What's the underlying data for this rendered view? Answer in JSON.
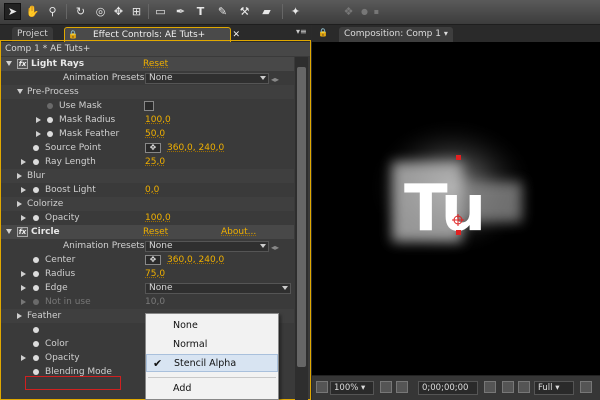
{
  "colors": {
    "accent": "#f0b000",
    "panel": "#3a3a3a",
    "highlight": "#d8e4f2",
    "red": "#d02020"
  },
  "toolbar": {
    "tools": [
      "selection-tool-icon",
      "hand-tool-icon",
      "zoom-tool-icon",
      "rotate-tool-icon",
      "orbit-camera-icon",
      "pan-behind-icon",
      "rectangle-tool-icon",
      "pen-tool-icon",
      "type-tool-icon",
      "brush-tool-icon",
      "eraser-tool-icon",
      "puppet-pin-icon"
    ]
  },
  "left_tabs": {
    "project": "Project",
    "effect_controls": "Effect Controls: AE Tuts+"
  },
  "ec_header": "Comp 1 * AE Tuts+",
  "effects": [
    {
      "name": "Light Rays",
      "reset": "Reset",
      "presets_label": "Animation Presets:",
      "presets_value": "None"
    },
    {
      "name": "Circle",
      "reset": "Reset",
      "about": "About...",
      "presets_label": "Animation Presets:",
      "presets_value": "None"
    }
  ],
  "params": {
    "preprocess": "Pre-Process",
    "use_mask": "Use Mask",
    "mask_radius": "Mask Radius",
    "mask_radius_val": "100,0",
    "mask_feather": "Mask Feather",
    "mask_feather_val": "50,0",
    "source_point": "Source Point",
    "source_point_val": "360,0, 240,0",
    "ray_length": "Ray Length",
    "ray_length_val": "25,0",
    "blur": "Blur",
    "boost_light": "Boost Light",
    "boost_light_val": "0,0",
    "colorize": "Colorize",
    "opacity": "Opacity",
    "opacity_val": "100,0",
    "center": "Center",
    "center_val": "360,0, 240,0",
    "radius": "Radius",
    "radius_val": "75,0",
    "edge": "Edge",
    "edge_val": "None",
    "not_in_use": "Not in use",
    "not_in_use_val": "10,0",
    "feather": "Feather",
    "color": "Color",
    "opacity2": "Opacity",
    "blending_mode": "Blending Mode"
  },
  "menu": {
    "items": [
      "None",
      "Normal",
      "Stencil Alpha",
      "Add"
    ],
    "selected": "Stencil Alpha"
  },
  "comp_tab": "Composition: Comp 1",
  "viewer": {
    "zoom": "100%",
    "timecode": "0;00;00;00",
    "resolution": "Full",
    "text": "Tu"
  }
}
